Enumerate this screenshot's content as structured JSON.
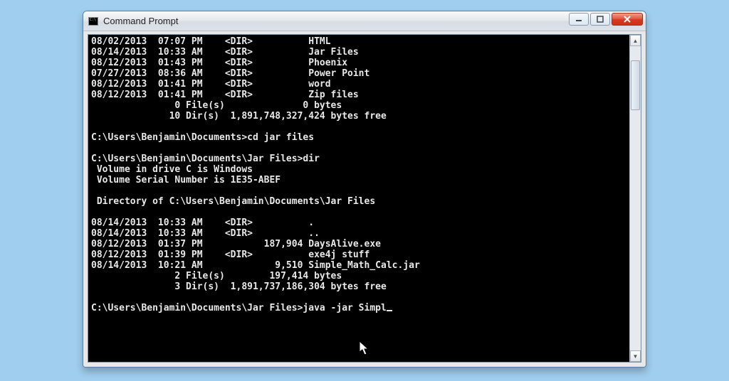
{
  "window": {
    "title": "Command Prompt"
  },
  "dir1": {
    "rows": [
      {
        "date": "08/02/2013",
        "time": "07:07 PM",
        "dir": "<DIR>",
        "size": "",
        "name": "HTML"
      },
      {
        "date": "08/14/2013",
        "time": "10:33 AM",
        "dir": "<DIR>",
        "size": "",
        "name": "Jar Files"
      },
      {
        "date": "08/12/2013",
        "time": "01:43 PM",
        "dir": "<DIR>",
        "size": "",
        "name": "Phoenix"
      },
      {
        "date": "07/27/2013",
        "time": "08:36 AM",
        "dir": "<DIR>",
        "size": "",
        "name": "Power Point"
      },
      {
        "date": "08/12/2013",
        "time": "01:41 PM",
        "dir": "<DIR>",
        "size": "",
        "name": "word"
      },
      {
        "date": "08/12/2013",
        "time": "01:41 PM",
        "dir": "<DIR>",
        "size": "",
        "name": "Zip files"
      }
    ],
    "summary_files": "               0 File(s)              0 bytes",
    "summary_dirs": "              10 Dir(s)  1,891,748,327,424 bytes free"
  },
  "cmd1": {
    "prompt": "C:\\Users\\Benjamin\\Documents>",
    "command": "cd jar files"
  },
  "cmd2": {
    "prompt": "C:\\Users\\Benjamin\\Documents\\Jar Files>",
    "command": "dir"
  },
  "vol": {
    "line1": " Volume in drive C is Windows",
    "line2": " Volume Serial Number is 1E35-ABEF"
  },
  "dir_of": " Directory of C:\\Users\\Benjamin\\Documents\\Jar Files",
  "dir2": {
    "rows": [
      {
        "date": "08/14/2013",
        "time": "10:33 AM",
        "dir": "<DIR>",
        "size": "",
        "name": "."
      },
      {
        "date": "08/14/2013",
        "time": "10:33 AM",
        "dir": "<DIR>",
        "size": "",
        "name": ".."
      },
      {
        "date": "08/12/2013",
        "time": "01:37 PM",
        "dir": "",
        "size": "187,904",
        "name": "DaysAlive.exe"
      },
      {
        "date": "08/12/2013",
        "time": "01:39 PM",
        "dir": "<DIR>",
        "size": "",
        "name": "exe4j stuff"
      },
      {
        "date": "08/14/2013",
        "time": "10:21 AM",
        "dir": "",
        "size": "9,510",
        "name": "Simple_Math_Calc.jar"
      }
    ],
    "summary_files": "               2 File(s)        197,414 bytes",
    "summary_dirs": "               3 Dir(s)  1,891,737,186,304 bytes free"
  },
  "cmd3": {
    "prompt": "C:\\Users\\Benjamin\\Documents\\Jar Files>",
    "command": "java -jar Simpl"
  }
}
